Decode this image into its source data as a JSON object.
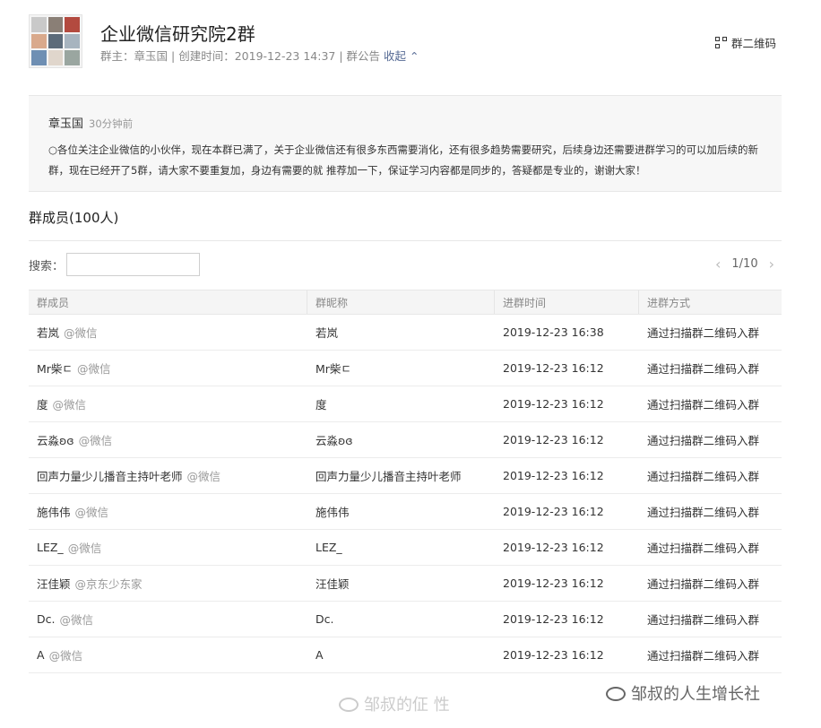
{
  "group": {
    "name": "企业微信研究院2群",
    "owner_label": "群主：",
    "owner_name": "章玉国",
    "created_label": "创建时间：",
    "created_time": "2019-12-23 14:37",
    "notice_label": "群公告",
    "collapse_label": "收起",
    "qr_label": "群二维码"
  },
  "notice": {
    "author": "章玉国",
    "time": "30分钟前",
    "text": "○各位关注企业微信的小伙伴，现在本群已满了，关于企业微信还有很多东西需要消化，还有很多趋势需要研究，后续身边还需要进群学习的可以加后续的新群，现在已经开了5群，请大家不要重复加，身边有需要的就 推荐加一下，保证学习内容都是同步的，答疑都是专业的，谢谢大家！"
  },
  "members": {
    "title": "群成员(100人)",
    "search_label": "搜索：",
    "search_placeholder": "",
    "page_indicator": "1/10",
    "columns": [
      "群成员",
      "群昵称",
      "进群时间",
      "进群方式"
    ],
    "rows": [
      {
        "name": "若岚",
        "source": "@微信",
        "nickname": "若岚",
        "join_time": "2019-12-23 16:38",
        "method": "通过扫描群二维码入群"
      },
      {
        "name": "Mr柴ㄷ",
        "source": "@微信",
        "nickname": "Mr柴ㄷ",
        "join_time": "2019-12-23 16:12",
        "method": "通过扫描群二维码入群"
      },
      {
        "name": "度",
        "source": "@微信",
        "nickname": "度",
        "join_time": "2019-12-23 16:12",
        "method": "通过扫描群二维码入群"
      },
      {
        "name": "云淼ʚɞ",
        "source": "@微信",
        "nickname": "云淼ʚɞ",
        "join_time": "2019-12-23 16:12",
        "method": "通过扫描群二维码入群"
      },
      {
        "name": "回声力量少儿播音主持叶老师",
        "source": "@微信",
        "nickname": "回声力量少儿播音主持叶老师",
        "join_time": "2019-12-23 16:12",
        "method": "通过扫描群二维码入群"
      },
      {
        "name": "施伟伟",
        "source": "@微信",
        "nickname": "施伟伟",
        "join_time": "2019-12-23 16:12",
        "method": "通过扫描群二维码入群"
      },
      {
        "name": "LEZ_",
        "source": "@微信",
        "nickname": "LEZ_",
        "join_time": "2019-12-23 16:12",
        "method": "通过扫描群二维码入群"
      },
      {
        "name": "汪佳颖",
        "source": "@京东少东家",
        "nickname": "汪佳颖",
        "join_time": "2019-12-23 16:12",
        "method": "通过扫描群二维码入群"
      },
      {
        "name": "Dc.",
        "source": "@微信",
        "nickname": "Dc.",
        "join_time": "2019-12-23 16:12",
        "method": "通过扫描群二维码入群"
      },
      {
        "name": "A",
        "source": "@微信",
        "nickname": "A",
        "join_time": "2019-12-23 16:12",
        "method": "通过扫描群二维码入群"
      }
    ]
  },
  "watermarks": {
    "weibo": "邹叔的佂 性",
    "wechat": "邹叔的人生增长社"
  },
  "colors": {
    "link": "#576b95",
    "muted": "#888888",
    "notice_bg": "#f7f7f7"
  },
  "icons": {
    "qr": "qr-code-icon",
    "collapse": "chevron-up-icon",
    "prev": "chevron-left-icon",
    "next": "chevron-right-icon"
  }
}
